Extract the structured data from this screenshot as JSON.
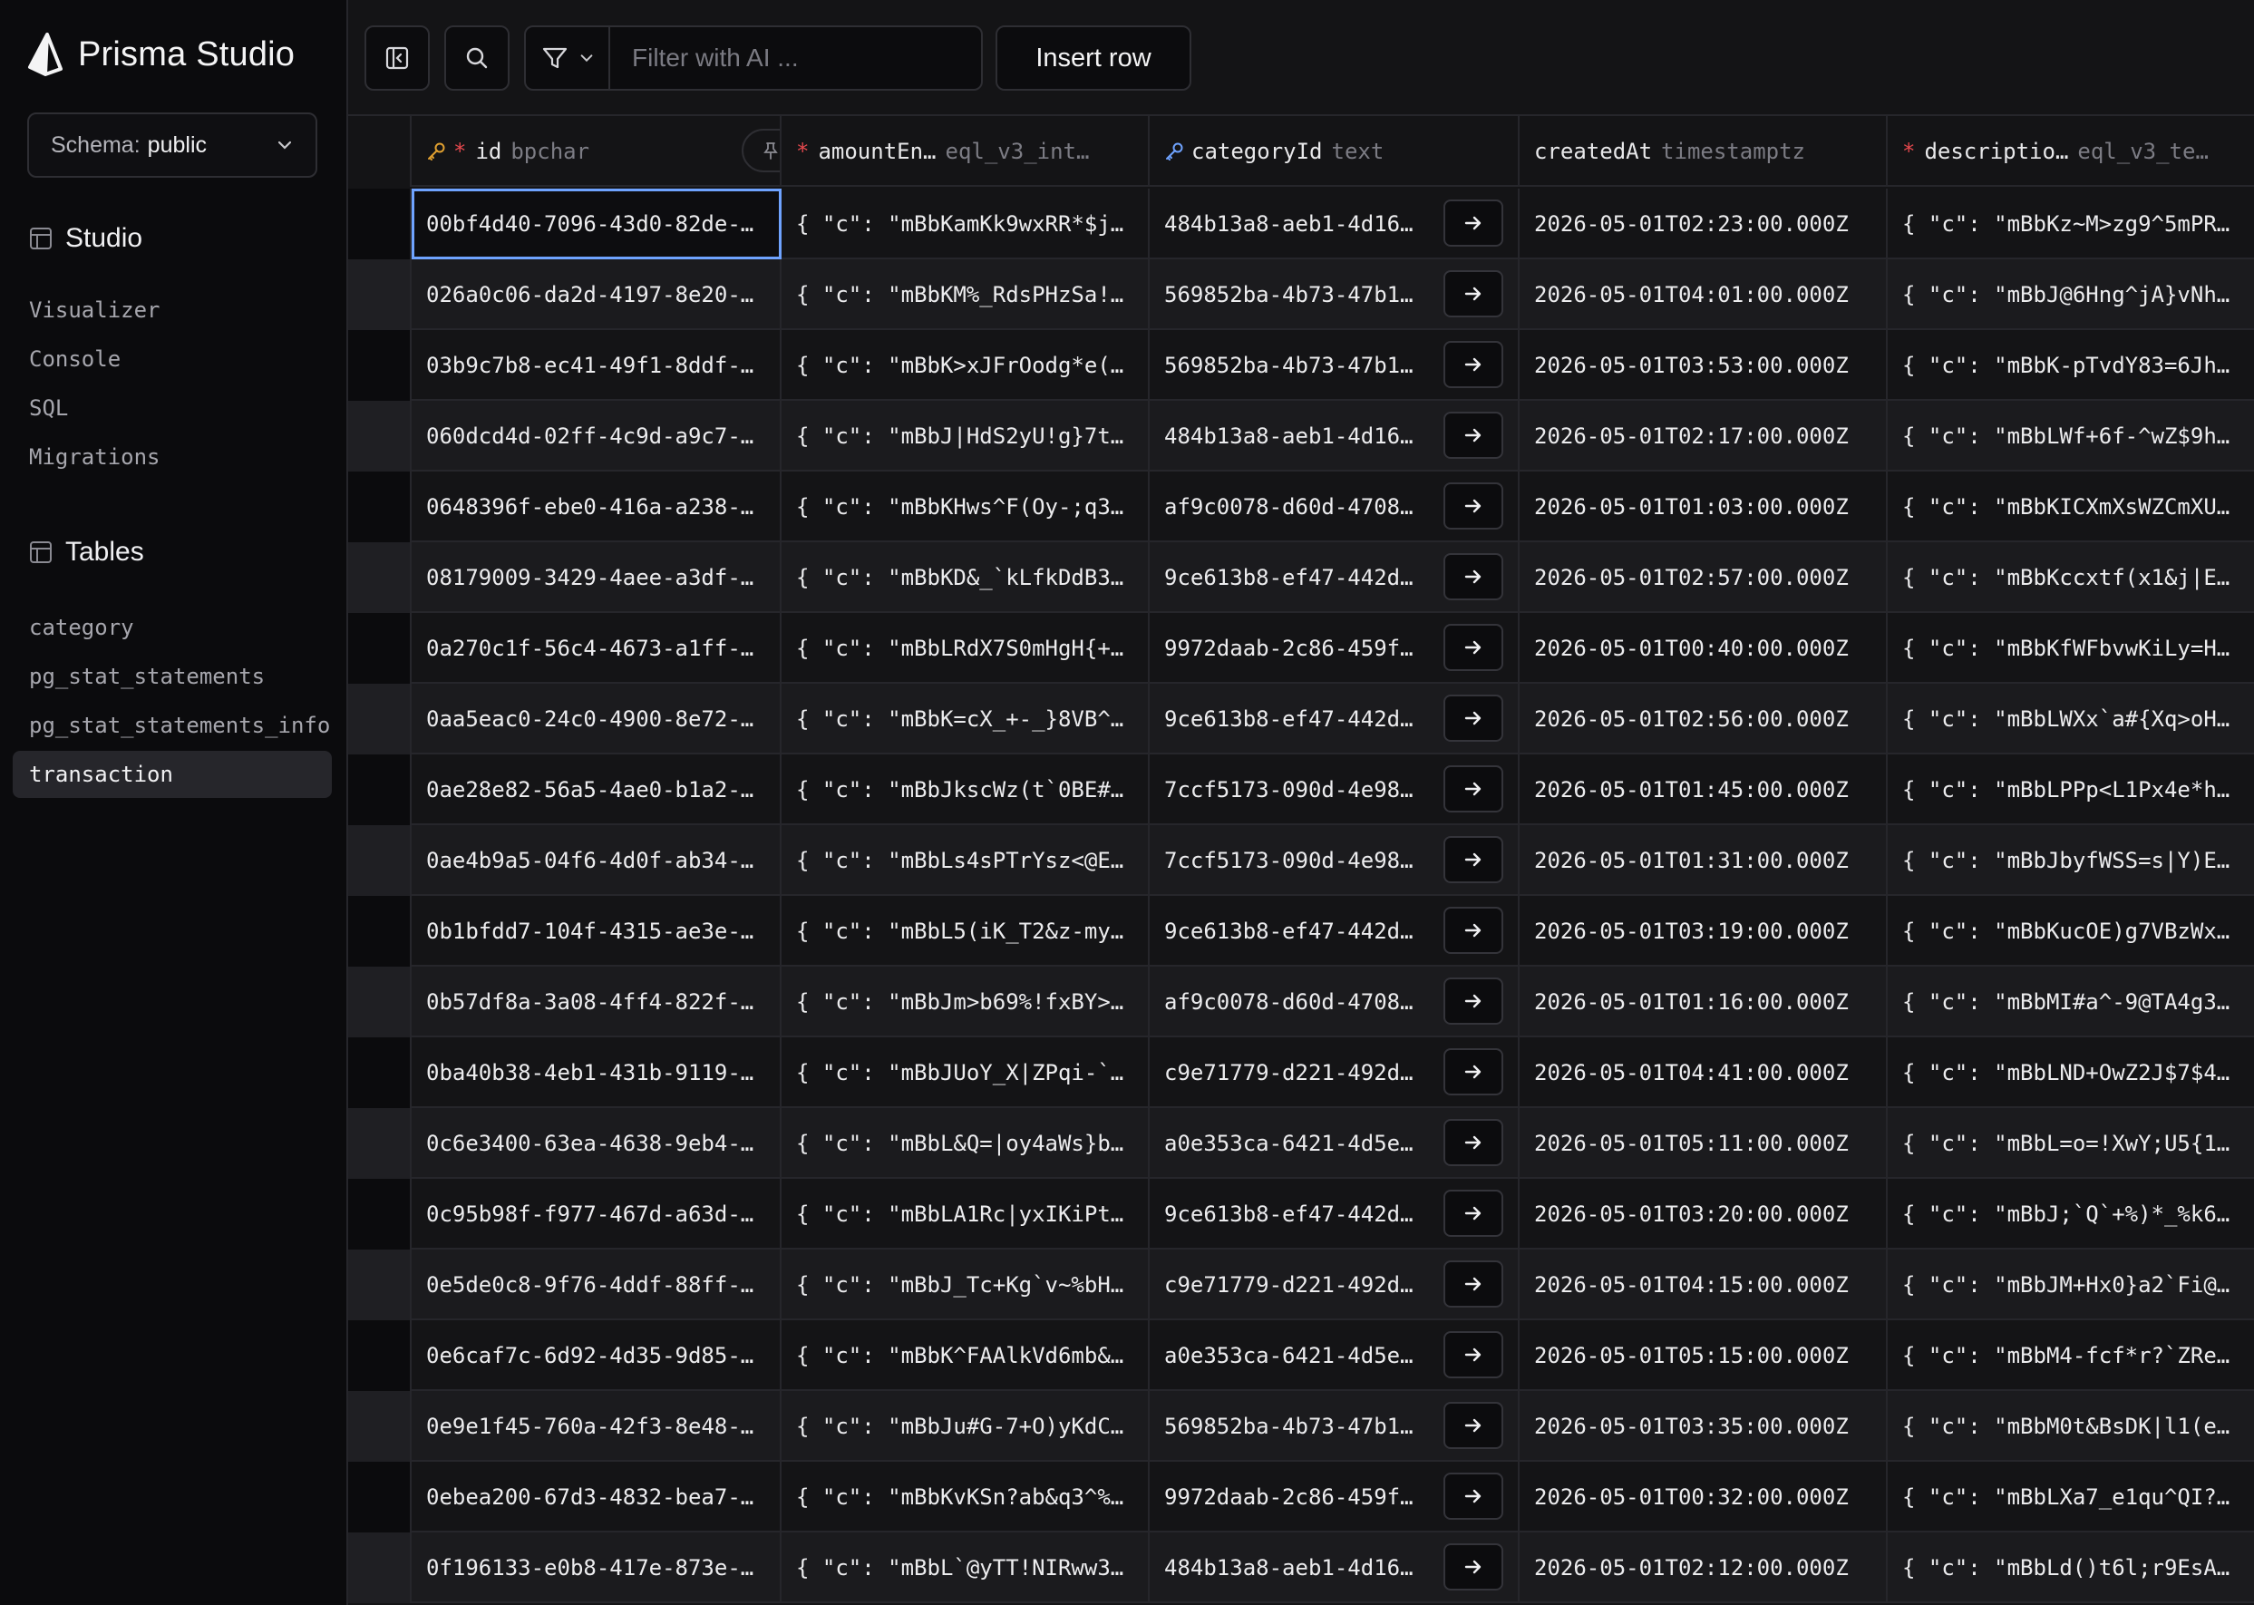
{
  "app": {
    "title": "Prisma Studio"
  },
  "schema": {
    "label": "Schema:",
    "value": "public"
  },
  "studio": {
    "heading": "Studio",
    "items": [
      "Visualizer",
      "Console",
      "SQL",
      "Migrations"
    ]
  },
  "tables": {
    "heading": "Tables",
    "items": [
      "category",
      "pg_stat_statements",
      "pg_stat_statements_info",
      "transaction"
    ],
    "active": "transaction"
  },
  "toolbar": {
    "filter_placeholder": "Filter with AI ...",
    "insert_label": "Insert row"
  },
  "columns": [
    {
      "name": "id",
      "type": "bpchar",
      "required": true,
      "key": "primary"
    },
    {
      "name": "amountEn…",
      "type": "eql_v3_int…",
      "required": true
    },
    {
      "name": "categoryId",
      "type": "text",
      "key": "foreign"
    },
    {
      "name": "createdAt",
      "type": "timestamptz"
    },
    {
      "name": "descriptio…",
      "type": "eql_v3_te…",
      "required": true
    }
  ],
  "rows": [
    [
      "00bf4d40-7096-43d0-82de-…",
      "{ \"c\": \"mBbKamKk9wxRR*$j…",
      "484b13a8-aeb1-4d16…",
      "2026-05-01T02:23:00.000Z",
      "{ \"c\": \"mBbKz~M>zg9^5mPR…"
    ],
    [
      "026a0c06-da2d-4197-8e20-…",
      "{ \"c\": \"mBbKM%_RdsPHzSa!…",
      "569852ba-4b73-47b1…",
      "2026-05-01T04:01:00.000Z",
      "{ \"c\": \"mBbJ@6Hng^jA}vNh…"
    ],
    [
      "03b9c7b8-ec41-49f1-8ddf-…",
      "{ \"c\": \"mBbK>xJFrOodg*e(…",
      "569852ba-4b73-47b1…",
      "2026-05-01T03:53:00.000Z",
      "{ \"c\": \"mBbK-pTvdY83=6Jh…"
    ],
    [
      "060dcd4d-02ff-4c9d-a9c7-…",
      "{ \"c\": \"mBbJ|HdS2yU!g}7t…",
      "484b13a8-aeb1-4d16…",
      "2026-05-01T02:17:00.000Z",
      "{ \"c\": \"mBbLWf+6f-^wZ$9h…"
    ],
    [
      "0648396f-ebe0-416a-a238-…",
      "{ \"c\": \"mBbKHws^F(Oy-;q3…",
      "af9c0078-d60d-4708…",
      "2026-05-01T01:03:00.000Z",
      "{ \"c\": \"mBbKICXmXsWZCmXU…"
    ],
    [
      "08179009-3429-4aee-a3df-…",
      "{ \"c\": \"mBbKD&_`kLfkDdB3…",
      "9ce613b8-ef47-442d…",
      "2026-05-01T02:57:00.000Z",
      "{ \"c\": \"mBbKccxtf(x1&j|E…"
    ],
    [
      "0a270c1f-56c4-4673-a1ff-…",
      "{ \"c\": \"mBbLRdX7S0mHgH{+…",
      "9972daab-2c86-459f…",
      "2026-05-01T00:40:00.000Z",
      "{ \"c\": \"mBbKfWFbvwKiLy=H…"
    ],
    [
      "0aa5eac0-24c0-4900-8e72-…",
      "{ \"c\": \"mBbK=cX_+-_}8VB^…",
      "9ce613b8-ef47-442d…",
      "2026-05-01T02:56:00.000Z",
      "{ \"c\": \"mBbLWXx`a#{Xq>oH…"
    ],
    [
      "0ae28e82-56a5-4ae0-b1a2-…",
      "{ \"c\": \"mBbJkscWz(t`0BE#…",
      "7ccf5173-090d-4e98…",
      "2026-05-01T01:45:00.000Z",
      "{ \"c\": \"mBbLPPp<L1Px4e*h…"
    ],
    [
      "0ae4b9a5-04f6-4d0f-ab34-…",
      "{ \"c\": \"mBbLs4sPTrYsz<@E…",
      "7ccf5173-090d-4e98…",
      "2026-05-01T01:31:00.000Z",
      "{ \"c\": \"mBbJbyfWSS=s|Y)E…"
    ],
    [
      "0b1bfdd7-104f-4315-ae3e-…",
      "{ \"c\": \"mBbL5(iK_T2&z-my…",
      "9ce613b8-ef47-442d…",
      "2026-05-01T03:19:00.000Z",
      "{ \"c\": \"mBbKucOE)g7VBzWx…"
    ],
    [
      "0b57df8a-3a08-4ff4-822f-…",
      "{ \"c\": \"mBbJm>b69%!fxBY>…",
      "af9c0078-d60d-4708…",
      "2026-05-01T01:16:00.000Z",
      "{ \"c\": \"mBbMI#a^-9@TA4g3…"
    ],
    [
      "0ba40b38-4eb1-431b-9119-…",
      "{ \"c\": \"mBbJUoY_X|ZPqi-`…",
      "c9e71779-d221-492d…",
      "2026-05-01T04:41:00.000Z",
      "{ \"c\": \"mBbLND+OwZ2J$7$4…"
    ],
    [
      "0c6e3400-63ea-4638-9eb4-…",
      "{ \"c\": \"mBbL&Q=|oy4aWs}b…",
      "a0e353ca-6421-4d5e…",
      "2026-05-01T05:11:00.000Z",
      "{ \"c\": \"mBbL=o=!XwY;U5{1…"
    ],
    [
      "0c95b98f-f977-467d-a63d-…",
      "{ \"c\": \"mBbLA1Rc|yxIKiPt…",
      "9ce613b8-ef47-442d…",
      "2026-05-01T03:20:00.000Z",
      "{ \"c\": \"mBbJ;`Q`+%)*_%k6…"
    ],
    [
      "0e5de0c8-9f76-4ddf-88ff-…",
      "{ \"c\": \"mBbJ_Tc+Kg`v~%bH…",
      "c9e71779-d221-492d…",
      "2026-05-01T04:15:00.000Z",
      "{ \"c\": \"mBbJM+Hx0}a2`Fi@…"
    ],
    [
      "0e6caf7c-6d92-4d35-9d85-…",
      "{ \"c\": \"mBbK^FAAlkVd6mb&…",
      "a0e353ca-6421-4d5e…",
      "2026-05-01T05:15:00.000Z",
      "{ \"c\": \"mBbM4-fcf*r?`ZRe…"
    ],
    [
      "0e9e1f45-760a-42f3-8e48-…",
      "{ \"c\": \"mBbJu#G-7+O)yKdC…",
      "569852ba-4b73-47b1…",
      "2026-05-01T03:35:00.000Z",
      "{ \"c\": \"mBbM0t&BsDK|l1(e…"
    ],
    [
      "0ebea200-67d3-4832-bea7-…",
      "{ \"c\": \"mBbKvKSn?ab&q3^%…",
      "9972daab-2c86-459f…",
      "2026-05-01T00:32:00.000Z",
      "{ \"c\": \"mBbLXa7_e1qu^QI?…"
    ],
    [
      "0f196133-e0b8-417e-873e-…",
      "{ \"c\": \"mBbL`@yTT!NIRww3…",
      "484b13a8-aeb1-4d16…",
      "2026-05-01T02:12:00.000Z",
      "{ \"c\": \"mBbLd()t6l;r9EsA…"
    ]
  ]
}
